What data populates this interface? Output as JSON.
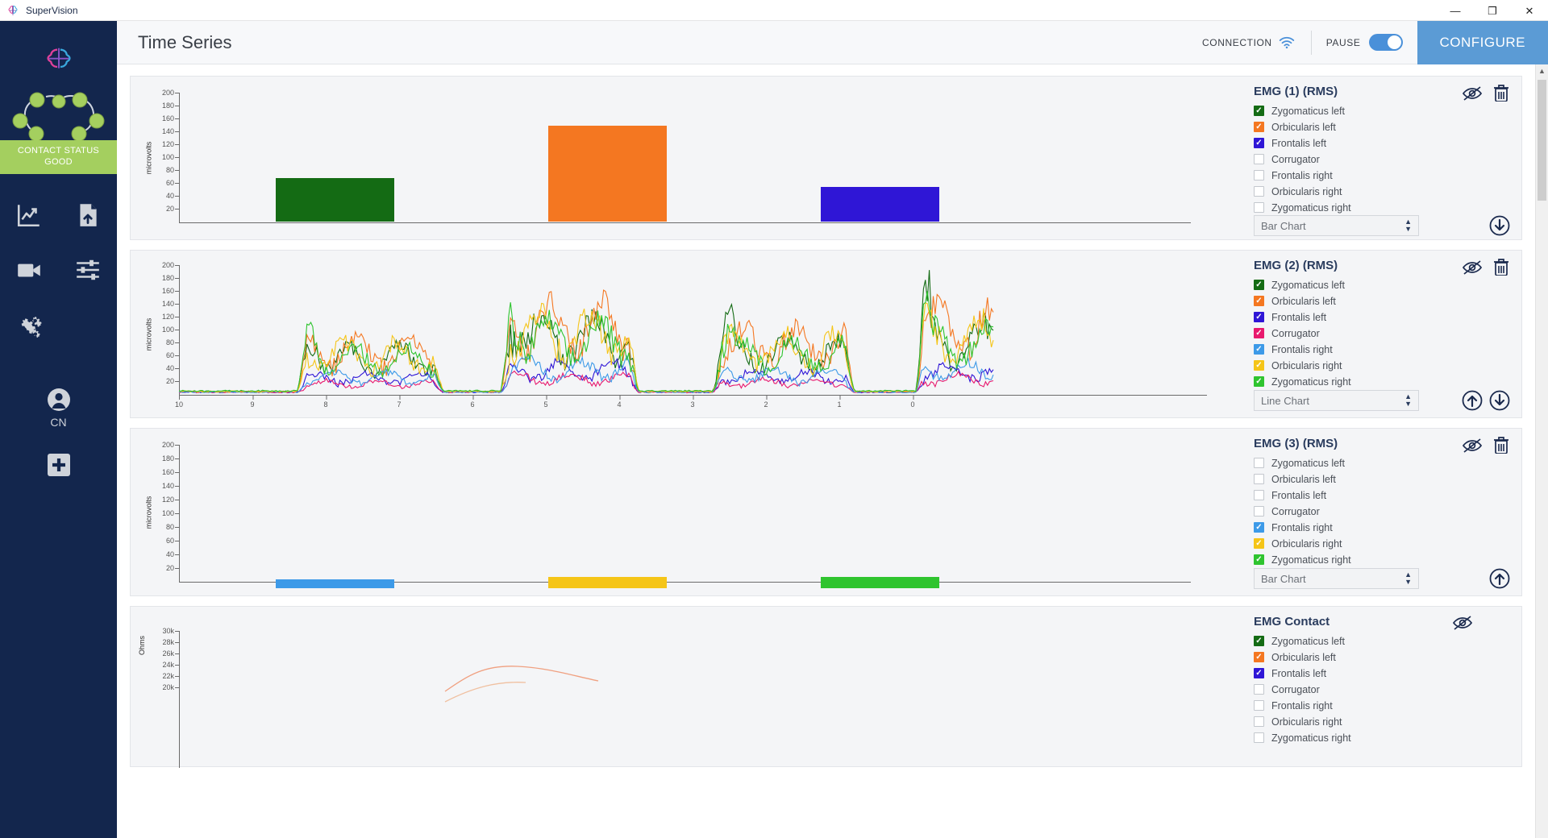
{
  "window": {
    "app_title": "SuperVision",
    "minimize": "—",
    "maximize": "❐",
    "close": "✕"
  },
  "sidebar": {
    "contact_status_line1": "CONTACT STATUS",
    "contact_status_line2": "GOOD",
    "contact_status_color": "#a4cf5f",
    "background_color": "#13264d",
    "nav_items": [
      {
        "name": "trend-chart-icon",
        "label": "Time Series"
      },
      {
        "name": "file-upload-icon",
        "label": "Upload"
      },
      {
        "name": "video-camera-icon",
        "label": "Video"
      },
      {
        "name": "sliders-icon",
        "label": "Settings Sliders"
      },
      {
        "name": "gears-icon",
        "label": "System"
      }
    ],
    "user_initials": "CN",
    "add_label": "+"
  },
  "header": {
    "title": "Time Series",
    "connection_label": "CONNECTION",
    "connection_icon": "wifi-icon",
    "pause_label": "PAUSE",
    "pause_on": true,
    "configure_label": "CONFIGURE",
    "configure_color": "#5b9bd5"
  },
  "muscles": [
    {
      "label": "Zygomaticus left",
      "color": "#146b14"
    },
    {
      "label": "Orbicularis left",
      "color": "#f47721"
    },
    {
      "label": "Frontalis left",
      "color": "#2f16d6"
    },
    {
      "label": "Corrugator",
      "color": "#e8196e"
    },
    {
      "label": "Frontalis right",
      "color": "#3d9ae8"
    },
    {
      "label": "Orbicularis right",
      "color": "#f5c518"
    },
    {
      "label": "Zygomaticus right",
      "color": "#2fc42f"
    }
  ],
  "panels": [
    {
      "title": "EMG (1) (RMS)",
      "chart_type_label": "Bar Chart",
      "checked": [
        true,
        true,
        true,
        false,
        false,
        false,
        false
      ],
      "icons": [
        "eye-off-icon",
        "trash-icon"
      ],
      "move_buttons": [
        "move-down-icon"
      ]
    },
    {
      "title": "EMG (2) (RMS)",
      "chart_type_label": "Line Chart",
      "checked": [
        true,
        true,
        true,
        true,
        true,
        true,
        true
      ],
      "icons": [
        "eye-off-icon",
        "trash-icon"
      ],
      "move_buttons": [
        "move-up-icon",
        "move-down-icon"
      ]
    },
    {
      "title": "EMG (3) (RMS)",
      "chart_type_label": "Bar Chart",
      "checked": [
        false,
        false,
        false,
        false,
        true,
        true,
        true
      ],
      "icons": [
        "eye-off-icon",
        "trash-icon"
      ],
      "move_buttons": [
        "move-up-icon"
      ]
    },
    {
      "title": "EMG Contact",
      "chart_type_label": "",
      "checked": [
        true,
        true,
        true,
        false,
        false,
        false,
        false
      ],
      "icons": [
        "eye-off-icon"
      ],
      "move_buttons": []
    }
  ],
  "chart_data": [
    {
      "type": "bar",
      "title": "EMG (1) (RMS)",
      "ylabel": "microvolts",
      "xlabel": "",
      "ylim": [
        0,
        200
      ],
      "yticks": [
        200,
        180,
        160,
        140,
        120,
        100,
        80,
        60,
        40,
        20
      ],
      "categories": [
        "Zygomaticus left",
        "Orbicularis left",
        "Frontalis left"
      ],
      "values": [
        67,
        147,
        53
      ],
      "colors": [
        "#146b14",
        "#f47721",
        "#2f16d6"
      ],
      "grid": false,
      "legend": "right"
    },
    {
      "type": "line",
      "title": "EMG (2) (RMS)",
      "ylabel": "microvolts",
      "xlabel": "",
      "ylim": [
        0,
        200
      ],
      "yticks": [
        200,
        180,
        160,
        140,
        120,
        100,
        80,
        60,
        40,
        20
      ],
      "xticks": [
        10,
        9,
        8,
        7,
        6,
        5,
        4,
        3,
        2,
        1,
        0
      ],
      "xlim": [
        10,
        0
      ],
      "grid": false,
      "legend": "right",
      "series": [
        {
          "name": "Zygomaticus left",
          "color": "#146b14",
          "peak": 112,
          "baseline": 4
        },
        {
          "name": "Orbicularis left",
          "color": "#f47721",
          "peak": 140,
          "baseline": 4
        },
        {
          "name": "Frontalis left",
          "color": "#2f16d6",
          "peak": 48,
          "baseline": 3
        },
        {
          "name": "Corrugator",
          "color": "#e8196e",
          "peak": 30,
          "baseline": 3
        },
        {
          "name": "Frontalis right",
          "color": "#3d9ae8",
          "peak": 52,
          "baseline": 3
        },
        {
          "name": "Orbicularis right",
          "color": "#f5c518",
          "peak": 133,
          "baseline": 4
        },
        {
          "name": "Zygomaticus right",
          "color": "#2fc42f",
          "peak": 118,
          "baseline": 5
        }
      ]
    },
    {
      "type": "bar",
      "title": "EMG (3) (RMS)",
      "ylabel": "microvolts",
      "xlabel": "",
      "ylim": [
        0,
        200
      ],
      "yticks": [
        200,
        180,
        160,
        140,
        120,
        100,
        80,
        60,
        40,
        20
      ],
      "categories": [
        "Frontalis right",
        "Orbicularis right",
        "Zygomaticus right"
      ],
      "values": [
        13,
        17,
        17
      ],
      "colors": [
        "#3d9ae8",
        "#f5c518",
        "#2fc42f"
      ],
      "grid": false,
      "legend": "right"
    },
    {
      "type": "line",
      "title": "EMG Contact",
      "ylabel": "Ohms",
      "xlabel": "",
      "ylim": [
        20000,
        30000
      ],
      "yticks": [
        "30k",
        "28k",
        "26k",
        "24k",
        "22k",
        "20k"
      ],
      "grid": false,
      "legend": "right"
    }
  ]
}
